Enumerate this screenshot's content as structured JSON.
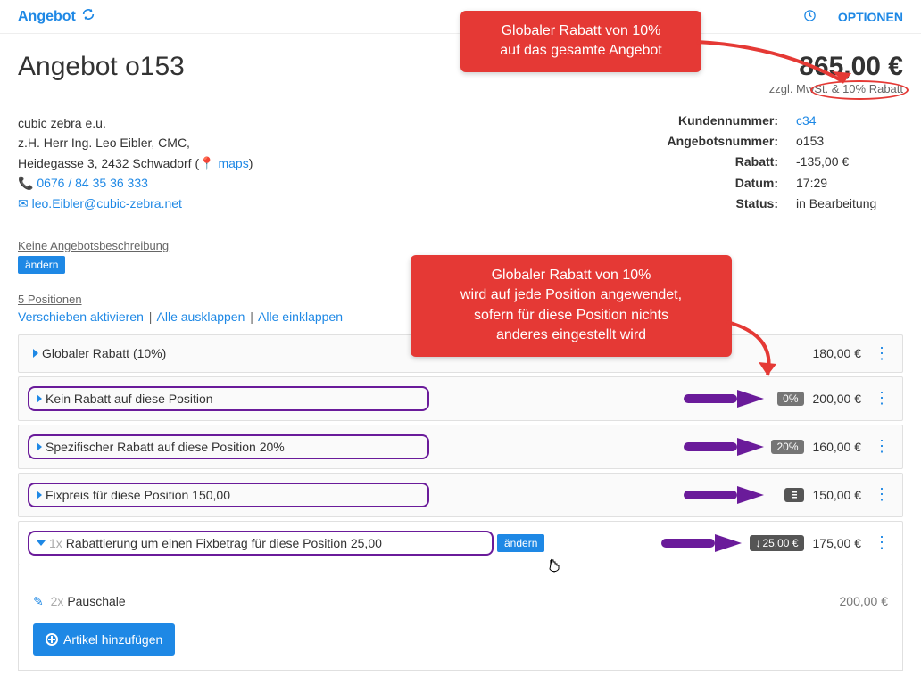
{
  "header": {
    "title": "Angebot",
    "optionen": "OPTIONEN"
  },
  "page": {
    "title": "Angebot o153",
    "price": "865,00 €",
    "price_sub": "zzgl. MwSt. & 10% Rabatt"
  },
  "company": {
    "name": "cubic zebra e.u.",
    "contact": "z.H. Herr Ing. Leo Eibler, CMC,",
    "address": "Heidegasse 3, 2432 Schwadorf (",
    "maps": "maps",
    "address_close": ")",
    "phone": "0676 / 84 35 36 333",
    "email": "leo.Eibler@cubic-zebra.net"
  },
  "details": {
    "kundennummer_label": "Kundennummer:",
    "kundennummer_val": "c34",
    "angebotsnummer_label": "Angebotsnummer:",
    "angebotsnummer_val": "o153",
    "rabatt_label": "Rabatt:",
    "rabatt_val": "-135,00 €",
    "datum_label": "Datum:",
    "datum_val": "17:29",
    "status_label": "Status:",
    "status_val": "in Bearbeitung"
  },
  "desc": {
    "no_desc": "Keine Angebotsbeschreibung",
    "aendern": "ändern"
  },
  "positions": {
    "count_link": "5 Positionen",
    "verschieben": "Verschieben aktivieren",
    "ausklappen": "Alle ausklappen",
    "einklappen": "Alle einklappen",
    "rows": [
      {
        "label": "Globaler Rabatt (10%)",
        "price": "180,00 €"
      },
      {
        "label": "Kein Rabatt auf diese Position",
        "badge": "0%",
        "price": "200,00 €"
      },
      {
        "label": "Spezifischer Rabatt auf diese Position 20%",
        "badge": "20%",
        "price": "160,00 €"
      },
      {
        "label": "Fixpreis für diese Position 150,00",
        "badge_icon": "calc",
        "price": "150,00 €"
      },
      {
        "prefix": "1x",
        "label": "Rabattierung um einen Fixbetrag für diese Position 25,00",
        "aendern": "ändern",
        "badge": "25,00 €",
        "badge_arrow": true,
        "price": "175,00 €"
      }
    ],
    "sub_item": {
      "qty": "2x",
      "label": "Pauschale",
      "price": "200,00 €"
    },
    "add_btn": "Artikel hinzufügen"
  },
  "callouts": {
    "c1_l1": "Globaler Rabatt von 10%",
    "c1_l2": "auf das gesamte Angebot",
    "c2_l1": "Globaler Rabatt von 10%",
    "c2_l2": "wird auf jede Position angewendet,",
    "c2_l3": "sofern für diese Position nichts",
    "c2_l4": "anderes eingestellt wird"
  }
}
